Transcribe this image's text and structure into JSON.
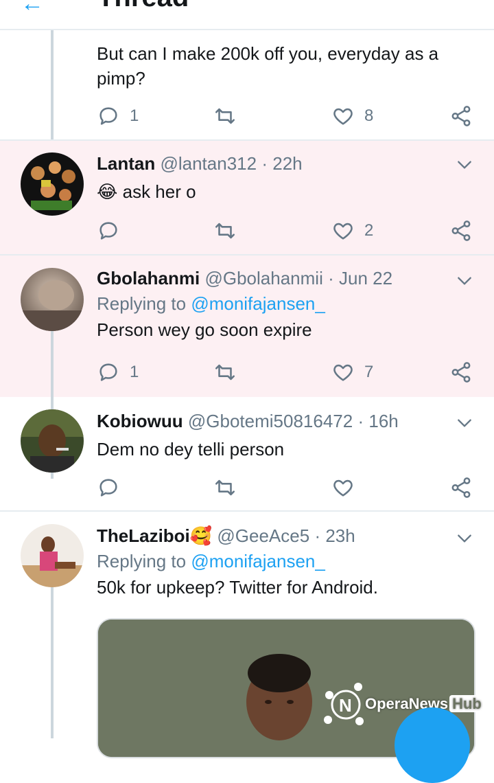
{
  "header": {
    "back_icon": "arrow-left-icon",
    "title": "Thread",
    "accent": "#1da1f2"
  },
  "tweets": [
    {
      "text": "But can I make 200k off you, everyday as a pimp?",
      "counts": {
        "reply": "1",
        "retweet": "",
        "like": "8"
      }
    },
    {
      "name": "Lantan",
      "handle": "@lantan312",
      "sep": "·",
      "time": "22h",
      "emoji": "😂",
      "text": "ask her o",
      "counts": {
        "reply": "",
        "retweet": "",
        "like": "2"
      }
    },
    {
      "name": "Gbolahanmi",
      "handle": "@Gbolahanmii",
      "sep": "·",
      "time": "Jun 22",
      "replying_prefix": "Replying to",
      "replying_to": "@monifajansen_",
      "text": "Person wey go soon expire",
      "counts": {
        "reply": "1",
        "retweet": "",
        "like": "7"
      }
    },
    {
      "name": "Kobiowuu",
      "handle": "@Gbotemi50816472",
      "sep": "·",
      "time": "16h",
      "text": "Dem no dey telli person",
      "counts": {
        "reply": "",
        "retweet": "",
        "like": ""
      }
    },
    {
      "name": "TheLaziboi",
      "name_emoji": "🥰",
      "handle": "@GeeAce5",
      "sep": "·",
      "time": "23h",
      "replying_prefix": "Replying to",
      "replying_to": "@monifajansen_",
      "text": "50k for upkeep? Twitter for Android."
    }
  ],
  "watermark": {
    "brand": "OperaNews",
    "suffix": "Hub"
  },
  "colors": {
    "highlight_bg": "#fdf0f3",
    "divider": "#e6ecf0",
    "muted": "#657786",
    "thread_line": "#ccd6dd"
  }
}
